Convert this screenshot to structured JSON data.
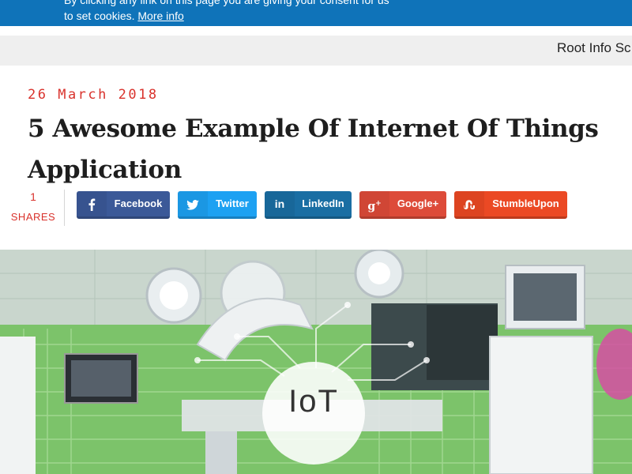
{
  "cookie_banner": {
    "text": "By clicking any link on this page you are giving your consent for us to set cookies.",
    "link_label": "More info"
  },
  "site": {
    "name": "Root Info Sc"
  },
  "article": {
    "date": "26 March 2018",
    "title": "5 Awesome Example Of Internet Of Things Application"
  },
  "shares": {
    "count": "1",
    "label": "SHARES",
    "buttons": [
      {
        "label": "Facebook",
        "icon": "f",
        "color": "#3b5998"
      },
      {
        "label": "Twitter",
        "icon": "twitter-bird",
        "color": "#1da1f2"
      },
      {
        "label": "LinkedIn",
        "icon": "in",
        "color": "#1a6ea3"
      },
      {
        "label": "Google+",
        "icon": "g+",
        "color": "#dd4b39"
      },
      {
        "label": "StumbleUpon",
        "icon": "su",
        "color": "#eb4924"
      }
    ]
  },
  "hero": {
    "badge": "IoT"
  }
}
